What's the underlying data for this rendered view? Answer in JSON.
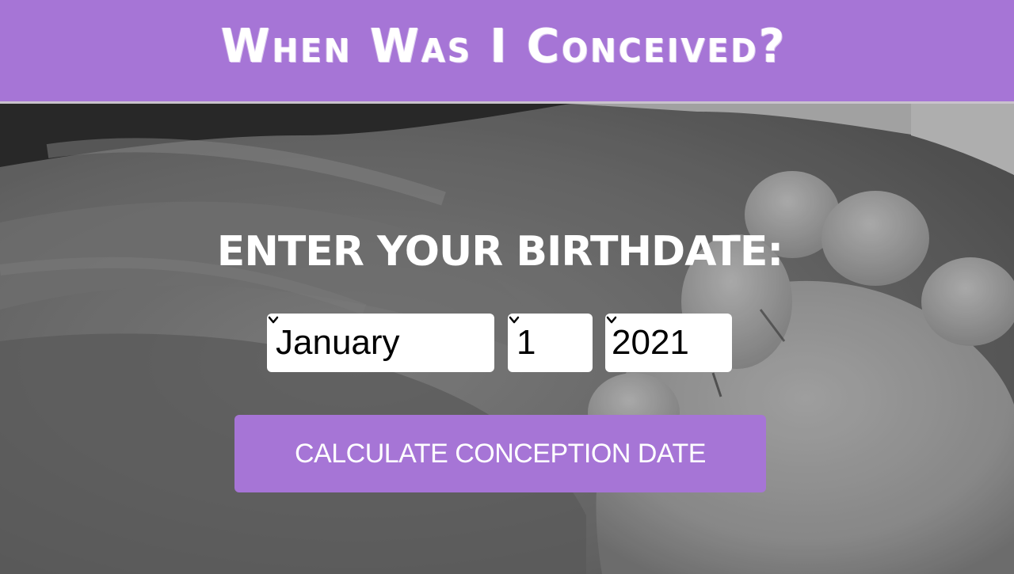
{
  "header": {
    "title": "When Was I Conceived?",
    "background_color": "#a675d6"
  },
  "hero": {
    "background_image": "baby-foot-on-towel-photo",
    "prompt": "ENTER YOUR BIRTHDATE:",
    "month_select": {
      "value": "January",
      "icon": "chevron-down-icon"
    },
    "day_select": {
      "value": "1",
      "icon": "chevron-down-icon"
    },
    "year_select": {
      "value": "2021",
      "icon": "chevron-down-icon"
    },
    "calculate_button": {
      "label": "CALCULATE CONCEPTION DATE",
      "color": "#a675d6"
    }
  }
}
